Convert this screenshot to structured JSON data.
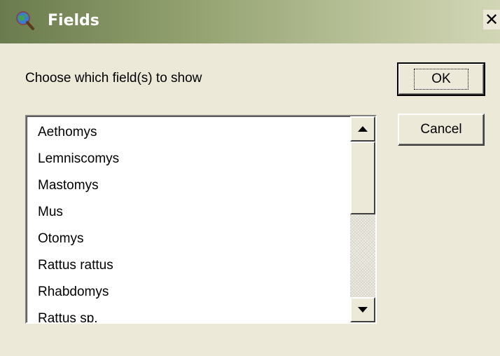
{
  "window": {
    "title": "Fields",
    "title_icon": "globe-magnifier-icon",
    "close_glyph": "✕"
  },
  "prompt": "Choose which field(s) to show",
  "buttons": {
    "ok_label": "OK",
    "cancel_label": "Cancel"
  },
  "field_list": {
    "items": [
      "Aethomys",
      "Lemniscomys",
      "Mastomys",
      "Mus",
      "Otomys",
      "Rattus rattus",
      "Rhabdomys",
      "Rattus sp."
    ],
    "scroll_position": 0
  },
  "colors": {
    "titlebar_start": "#6a7b4d",
    "titlebar_end": "#d2d6b6",
    "face": "#ece9d8"
  }
}
